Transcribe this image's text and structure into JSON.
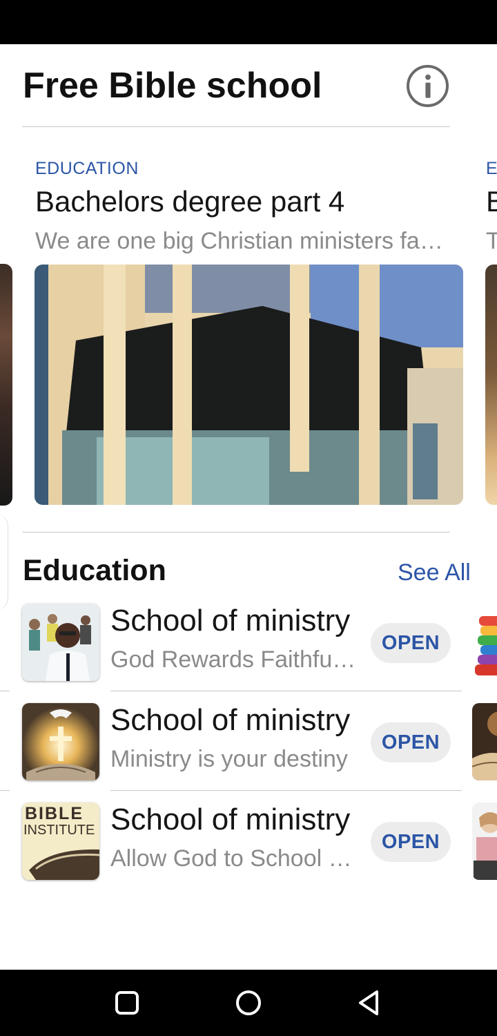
{
  "header": {
    "title": "Free Bible school"
  },
  "featured": {
    "category": "EDUCATION",
    "title": "Bachelors degree part 4",
    "description": "We are one big Christian ministers family"
  },
  "featured_next": {
    "category": "E",
    "title": "B",
    "description": "T"
  },
  "section": {
    "title": "Education",
    "see_all": "See All"
  },
  "items": [
    {
      "title": "School of ministry",
      "subtitle": "God Rewards  Faithfulness",
      "action": "OPEN"
    },
    {
      "title": "School of ministry",
      "subtitle": "Ministry is your destiny",
      "action": "OPEN"
    },
    {
      "title": "School of ministry",
      "subtitle": "Allow God to School you",
      "action": "OPEN"
    }
  ],
  "thumb_text": {
    "line1": "BIBLE",
    "line2": "INSTITUTE"
  },
  "colors": {
    "accent": "#2b55a6",
    "button_bg": "#ececec"
  }
}
